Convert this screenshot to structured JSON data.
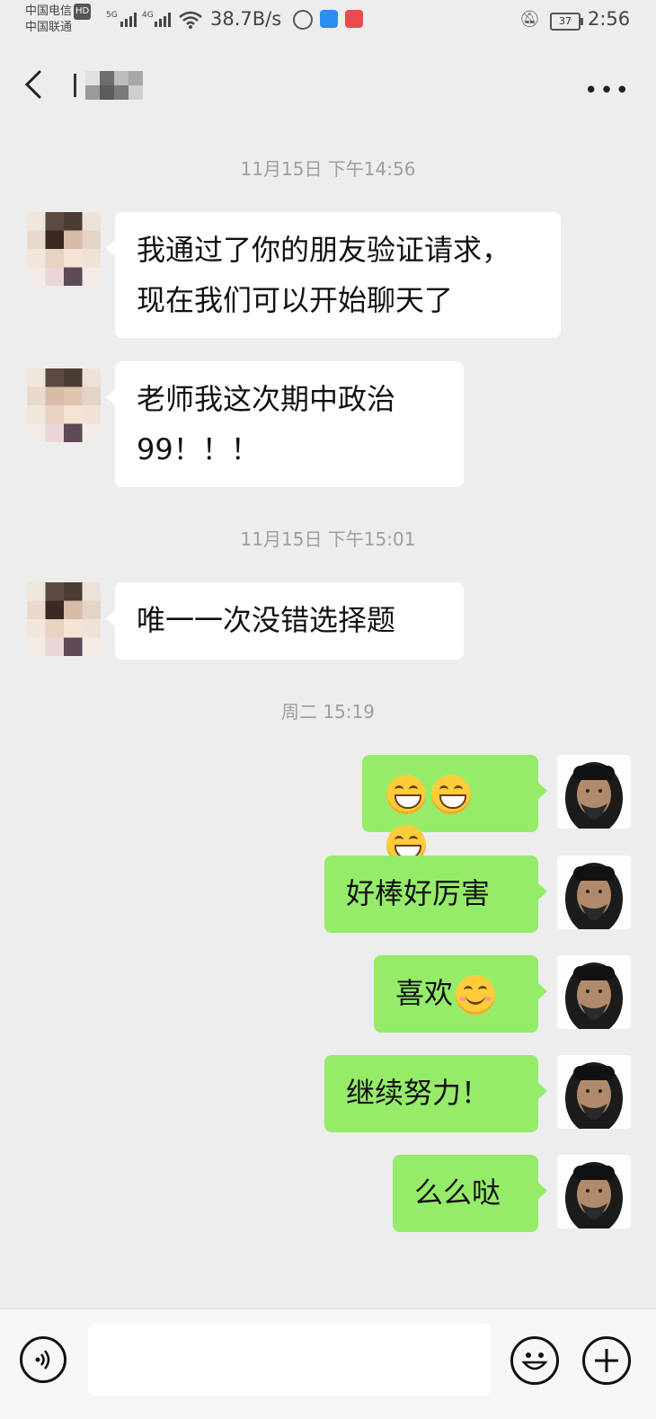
{
  "status_bar": {
    "carrier_1": "中国电信",
    "carrier_1_badge": "HD",
    "carrier_2": "中国联通",
    "sig_1": "5G",
    "sig_2": "4G",
    "net_speed": "38.7B/s",
    "battery": "37",
    "time": "2:56"
  },
  "header": {
    "contact_name": "l",
    "more_label": "•••"
  },
  "timestamps": [
    "11月15日 下午14:56",
    "11月15日 下午15:01",
    "周二 15:19"
  ],
  "messages_in": [
    {
      "line1": "我通过了你的朋友验证请求，",
      "line2": "现在我们可以开始聊天了"
    },
    {
      "line1": "老师我这次期中政治",
      "line2": "99！！！"
    },
    {
      "line1": "唯一一次没错选择题"
    }
  ],
  "messages_out": [
    {
      "text": "",
      "emoji": "grin-emoji ×3"
    },
    {
      "text": "好棒好厉害"
    },
    {
      "text": "喜欢",
      "emoji": "smile-emoji"
    },
    {
      "text": "继续努力！"
    },
    {
      "text": "么么哒"
    }
  ],
  "colors": {
    "background": "#ededed",
    "bubble_out": "#95ec69",
    "bubble_in": "#ffffff",
    "timestamp": "#9e9e9e"
  }
}
